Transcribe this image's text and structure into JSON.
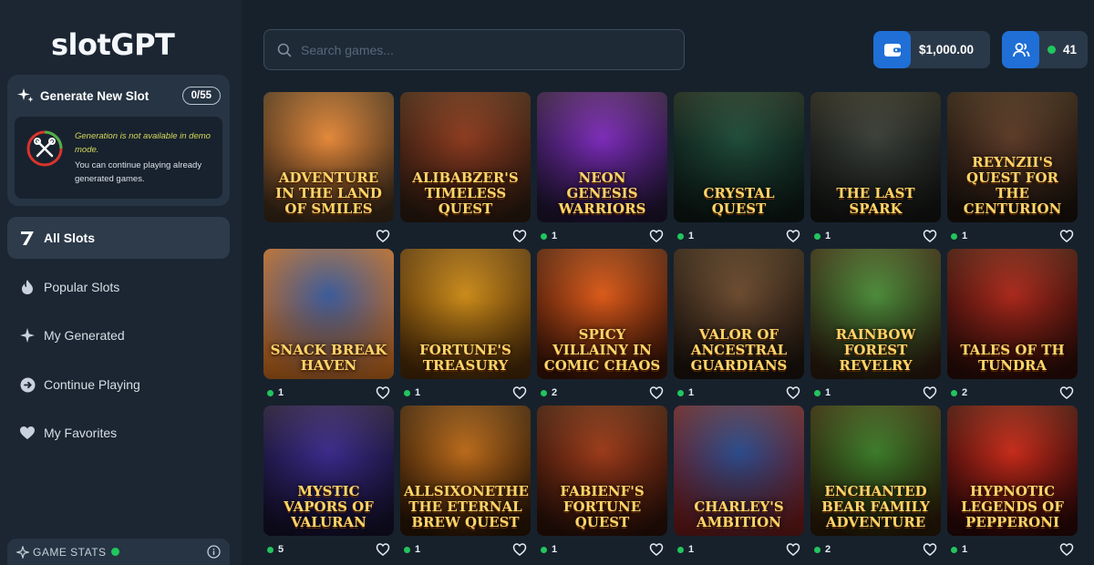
{
  "app": {
    "logo": "slotGPT"
  },
  "generate": {
    "title": "Generate New Slot",
    "count": "0/55",
    "warning": "Generation is not available in demo mode.",
    "note": "You can continue playing already generated games."
  },
  "nav": [
    {
      "label": "All Slots",
      "icon": "seven-icon",
      "active": true
    },
    {
      "label": "Popular Slots",
      "icon": "flame-icon"
    },
    {
      "label": "My Generated",
      "icon": "sparkle-icon"
    },
    {
      "label": "Continue Playing",
      "icon": "arrow-circle-icon"
    },
    {
      "label": "My Favorites",
      "icon": "heart-icon"
    }
  ],
  "stats": {
    "label": "GAME STATS"
  },
  "search": {
    "placeholder": "Search games..."
  },
  "balance": {
    "value": "$1,000.00"
  },
  "online": {
    "count": "41"
  },
  "games": [
    {
      "title": "Adventure in the Land of Smiles",
      "count": "",
      "c1": "#e2873a",
      "c2": "#3b2a1a"
    },
    {
      "title": "Alibabzer's Timeless Quest",
      "count": "",
      "c1": "#8b3a1f",
      "c2": "#2b1a10"
    },
    {
      "title": "Neon Genesis Warriors",
      "count": "1",
      "c1": "#7b2bb8",
      "c2": "#1e1430"
    },
    {
      "title": "Crystal Quest",
      "count": "1",
      "c1": "#1f4b3a",
      "c2": "#0c1815"
    },
    {
      "title": "The Last Spark",
      "count": "1",
      "c1": "#3a3f3a",
      "c2": "#121412"
    },
    {
      "title": "Reynzii's Quest for the Centurion",
      "count": "1",
      "c1": "#5a3a28",
      "c2": "#1a120c"
    },
    {
      "title": "Snack Break Haven",
      "count": "1",
      "c1": "#3a5a9a",
      "c2": "#c46a20"
    },
    {
      "title": "Fortune's Treasury",
      "count": "1",
      "c1": "#c98a1a",
      "c2": "#4a2a08"
    },
    {
      "title": "Spicy Villainy in Comic Chaos",
      "count": "2",
      "c1": "#d9591a",
      "c2": "#3a1408"
    },
    {
      "title": "Valor of Ancestral Guardians",
      "count": "1",
      "c1": "#6a4a30",
      "c2": "#1c140e"
    },
    {
      "title": "Rainbow Forest Revelry",
      "count": "1",
      "c1": "#4a8a3a",
      "c2": "#2a1a0e"
    },
    {
      "title": "Tales of th Tundra",
      "count": "2",
      "c1": "#a8281c",
      "c2": "#2a0c08"
    },
    {
      "title": "Mystic Vapors of Valuran",
      "count": "5",
      "c1": "#3a2a8a",
      "c2": "#14102a"
    },
    {
      "title": "Allsixonethe The Eternal Brew Quest",
      "count": "1",
      "c1": "#b8691a",
      "c2": "#2a1606"
    },
    {
      "title": "Fabienf's Fortune Quest",
      "count": "1",
      "c1": "#9a3a1a",
      "c2": "#2a1008"
    },
    {
      "title": "Charley's Ambition",
      "count": "1",
      "c1": "#2a4a8a",
      "c2": "#6a1a1a"
    },
    {
      "title": "Enchanted Bear Family Adventure",
      "count": "2",
      "c1": "#3a7a2a",
      "c2": "#2a1a08"
    },
    {
      "title": "Hypnotic Legends of Pepperoni",
      "count": "1",
      "c1": "#c42a1a",
      "c2": "#2a0808"
    }
  ]
}
